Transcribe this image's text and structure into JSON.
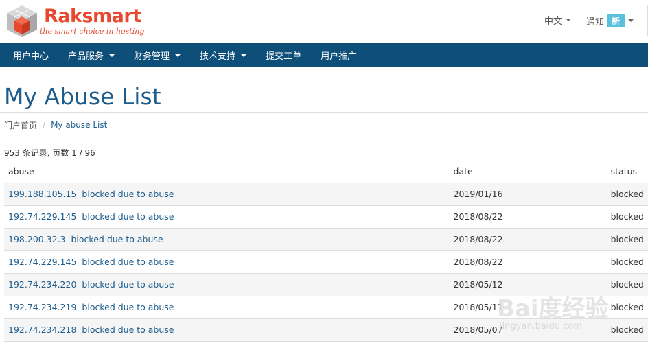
{
  "header": {
    "logo_name": "Raksmart",
    "logo_tagline": "the smart choice in hosting",
    "language_label": "中文",
    "notifications_label": "通知",
    "notifications_badge": "新"
  },
  "nav": {
    "items": [
      {
        "label": "用户中心",
        "has_dropdown": false
      },
      {
        "label": "产品服务",
        "has_dropdown": true
      },
      {
        "label": "财务管理",
        "has_dropdown": true
      },
      {
        "label": "技术支持",
        "has_dropdown": true
      },
      {
        "label": "提交工单",
        "has_dropdown": false
      },
      {
        "label": "用户推广",
        "has_dropdown": false
      }
    ]
  },
  "page": {
    "title": "My Abuse List"
  },
  "breadcrumb": {
    "home": "门户首页",
    "separator": "/",
    "current": "My abuse List"
  },
  "records": {
    "summary": "953 条记录, 页数 1 / 96"
  },
  "table": {
    "headers": {
      "abuse": "abuse",
      "date": "date",
      "status": "status"
    },
    "rows": [
      {
        "ip": "199.188.105.15",
        "reason": "blocked due to abuse",
        "date": "2019/01/16",
        "status": "blocked"
      },
      {
        "ip": "192.74.229.145",
        "reason": "blocked due to abuse",
        "date": "2018/08/22",
        "status": "blocked"
      },
      {
        "ip": "198.200.32.3",
        "reason": "blocked due to abuse",
        "date": "2018/08/22",
        "status": "blocked"
      },
      {
        "ip": "192.74.229.145",
        "reason": "blocked due to abuse",
        "date": "2018/08/22",
        "status": "blocked"
      },
      {
        "ip": "192.74.234.220",
        "reason": "blocked due to abuse",
        "date": "2018/05/12",
        "status": "blocked"
      },
      {
        "ip": "192.74.234.219",
        "reason": "blocked due to abuse",
        "date": "2018/05/11",
        "status": "blocked"
      },
      {
        "ip": "192.74.234.218",
        "reason": "blocked due to abuse",
        "date": "2018/05/07",
        "status": "blocked"
      }
    ]
  },
  "watermark": {
    "text": "Bai度经验",
    "sub": "jingyan.baidu.com"
  },
  "colors": {
    "brand": "#e8492e",
    "navbar": "#0e4f7a",
    "link": "#1d5d8e",
    "badge": "#5bc0de"
  }
}
